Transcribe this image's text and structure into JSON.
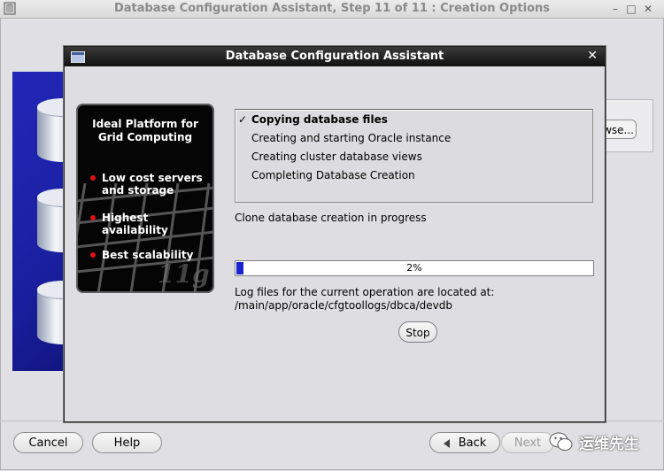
{
  "outer_window": {
    "title": "Database Configuration Assistant, Step 11 of 11 : Creation Options",
    "browse_label": "wse..."
  },
  "dialog": {
    "title": "Database Configuration Assistant",
    "close_glyph": "✕"
  },
  "promo": {
    "heading": "Ideal Platform for Grid Computing",
    "bullets": [
      "Low cost servers and storage",
      "Highest availability",
      "Best scalability"
    ],
    "logo_text": "g"
  },
  "steps": [
    {
      "label": "Copying database files",
      "status": "current"
    },
    {
      "label": "Creating and starting Oracle instance",
      "status": "pending"
    },
    {
      "label": "Creating cluster database views",
      "status": "pending"
    },
    {
      "label": "Completing Database Creation",
      "status": "pending"
    }
  ],
  "status_text": "Clone database creation in progress",
  "progress": {
    "percent": 2,
    "label": "2%"
  },
  "log": {
    "line1": "Log files for the current operation are located at:",
    "path": "/main/app/oracle/cfgtoollogs/dbca/devdb"
  },
  "buttons": {
    "stop": "Stop",
    "cancel": "Cancel",
    "help": "Help",
    "back": "Back",
    "next": "Next"
  },
  "watermark": {
    "text": "运维先生"
  },
  "colors": {
    "progress_fill": "#1a23d0",
    "bullet_dot": "#e01010",
    "dialog_titlebar": "#111111"
  }
}
